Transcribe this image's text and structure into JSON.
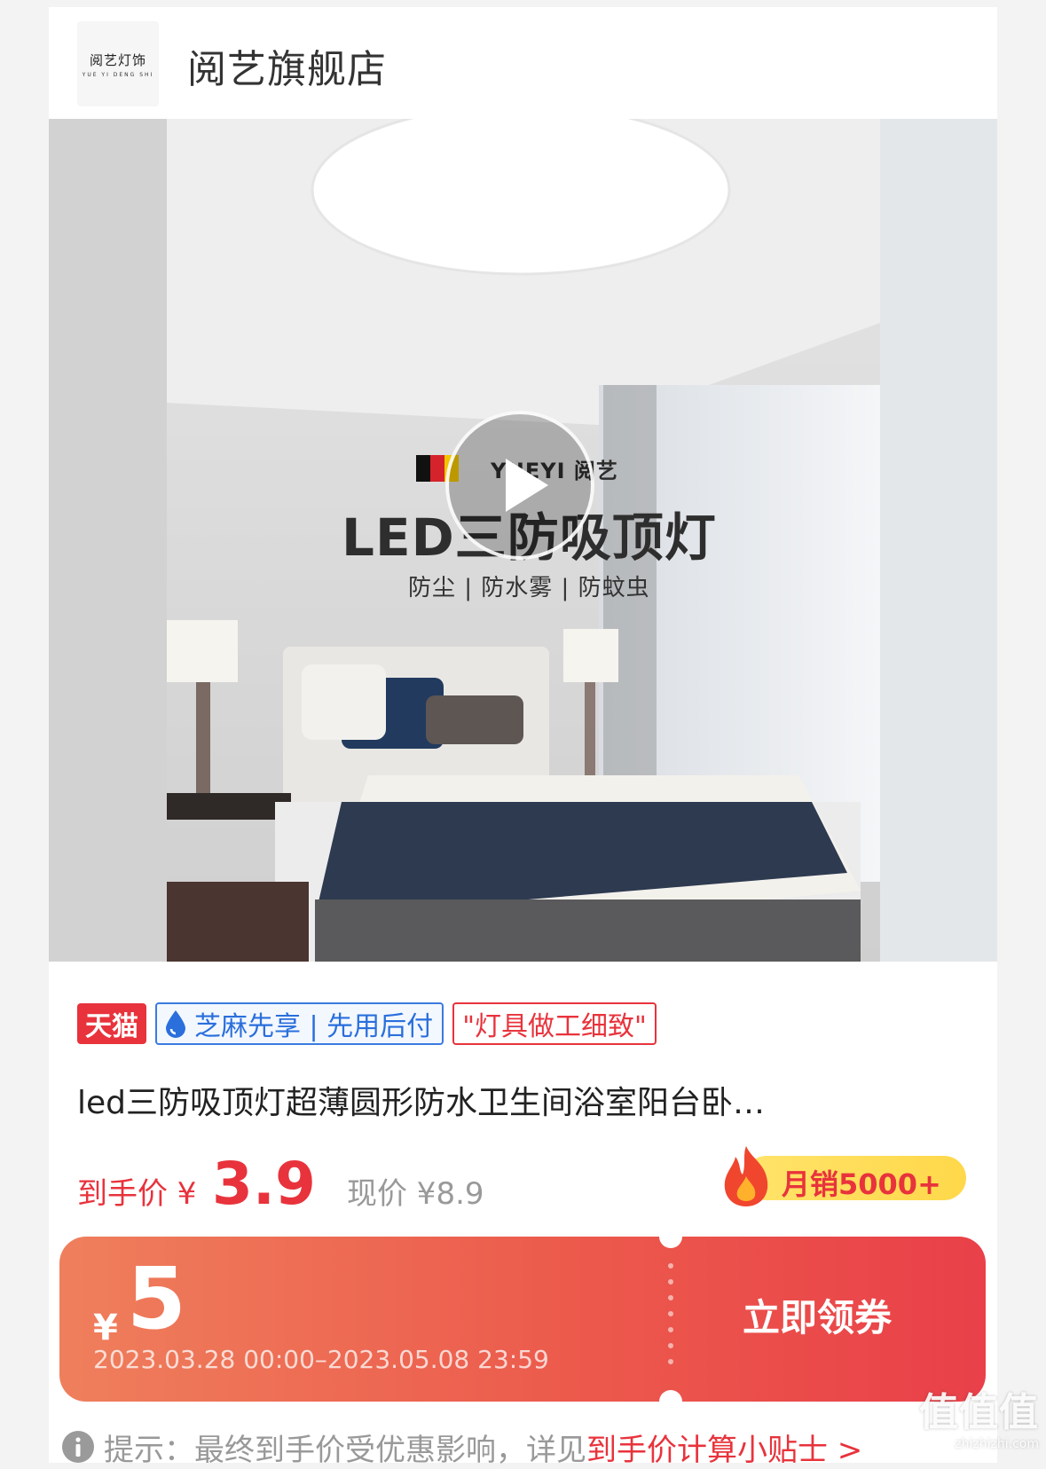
{
  "store": {
    "logo_text_cn": "阅艺灯饰",
    "logo_text_en": "YUE YI DENG SHI",
    "name": "阅艺旗舰店"
  },
  "media": {
    "overlay_brand": "YUEYI 阅艺",
    "overlay_title": "LED三防吸顶灯",
    "overlay_subtitle": "防尘 | 防水雾 | 防蚊虫",
    "play_icon": "play-icon"
  },
  "tags": {
    "platform": "天猫",
    "zhima": "芝麻先享 | 先用后付",
    "quote": "\"灯具做工细致\""
  },
  "product": {
    "title": "led三防吸顶灯超薄圆形防水卫生间浴室阳台卧…"
  },
  "price": {
    "label": "到手价 ¥",
    "final": "3.9",
    "current": "现价 ¥8.9"
  },
  "sales": {
    "text": "月销5000+",
    "icon": "fire-icon"
  },
  "coupon": {
    "currency": "¥",
    "amount": "5",
    "validity": "2023.03.28 00:00–2023.05.08 23:59",
    "button_label": "立即领券"
  },
  "tip": {
    "text": "提示：最终到手价受优惠影响，详见",
    "link": "到手价计算小贴士 >",
    "icon": "info-icon"
  },
  "watermark": {
    "text": "值值值",
    "site": "zhizhizhi.com"
  },
  "colors": {
    "accent": "#e8333c",
    "zhima_blue": "#2a6fdc",
    "coupon_start": "#ef7f5c",
    "coupon_end": "#e94049"
  }
}
